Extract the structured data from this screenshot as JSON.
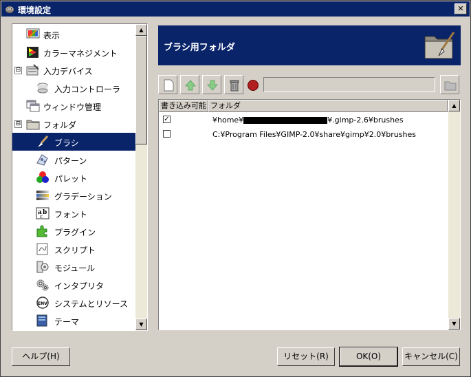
{
  "window": {
    "title": "環境設定",
    "close_glyph": "✕"
  },
  "sidebar": {
    "items": [
      {
        "label": "表示",
        "icon": "display-icon"
      },
      {
        "label": "カラーマネジメント",
        "icon": "color-management-icon"
      },
      {
        "label": "入力デバイス",
        "icon": "input-devices-icon",
        "expander": "⊟"
      },
      {
        "label": "入力コントローラ",
        "icon": "input-controllers-icon"
      },
      {
        "label": "ウィンドウ管理",
        "icon": "window-management-icon"
      },
      {
        "label": "フォルダ",
        "icon": "folders-icon",
        "expander": "⊟"
      },
      {
        "label": "ブラシ",
        "icon": "brush-icon",
        "selected": true
      },
      {
        "label": "パターン",
        "icon": "pattern-icon"
      },
      {
        "label": "パレット",
        "icon": "palette-icon"
      },
      {
        "label": "グラデーション",
        "icon": "gradient-icon"
      },
      {
        "label": "フォント",
        "icon": "font-icon"
      },
      {
        "label": "プラグイン",
        "icon": "plugin-icon"
      },
      {
        "label": "スクリプト",
        "icon": "script-icon"
      },
      {
        "label": "モジュール",
        "icon": "module-icon"
      },
      {
        "label": "インタプリタ",
        "icon": "interpreter-icon"
      },
      {
        "label": "システムとリソース",
        "icon": "environment-icon"
      },
      {
        "label": "テーマ",
        "icon": "theme-icon"
      }
    ]
  },
  "header": {
    "title": "ブラシ用フォルダ",
    "icon": "brush-folder-icon"
  },
  "toolbar": {
    "buttons": [
      "new-folder-icon",
      "move-up-icon",
      "move-down-icon",
      "delete-icon"
    ],
    "status_icon": "status-red-icon",
    "path_value": "",
    "browse_icon": "browse-folder-icon"
  },
  "list": {
    "headers": [
      "書き込み可能",
      "フォルダ"
    ],
    "rows": [
      {
        "writable": true,
        "check_glyph": "✓",
        "path_prefix": "¥home¥",
        "path_suffix": "¥.gimp-2.6¥brushes",
        "redacted": true
      },
      {
        "writable": false,
        "check_glyph": "",
        "path": "C:¥Program Files¥GIMP-2.0¥share¥gimp¥2.0¥brushes"
      }
    ]
  },
  "buttons": {
    "help": "ヘルプ(H)",
    "reset": "リセット(R)",
    "ok": "OK(O)",
    "cancel": "キャンセル(C)"
  },
  "colors": {
    "selection": "#0a246a",
    "header_bg": "#0a246a",
    "dialog_bg": "#d4d0c8"
  }
}
